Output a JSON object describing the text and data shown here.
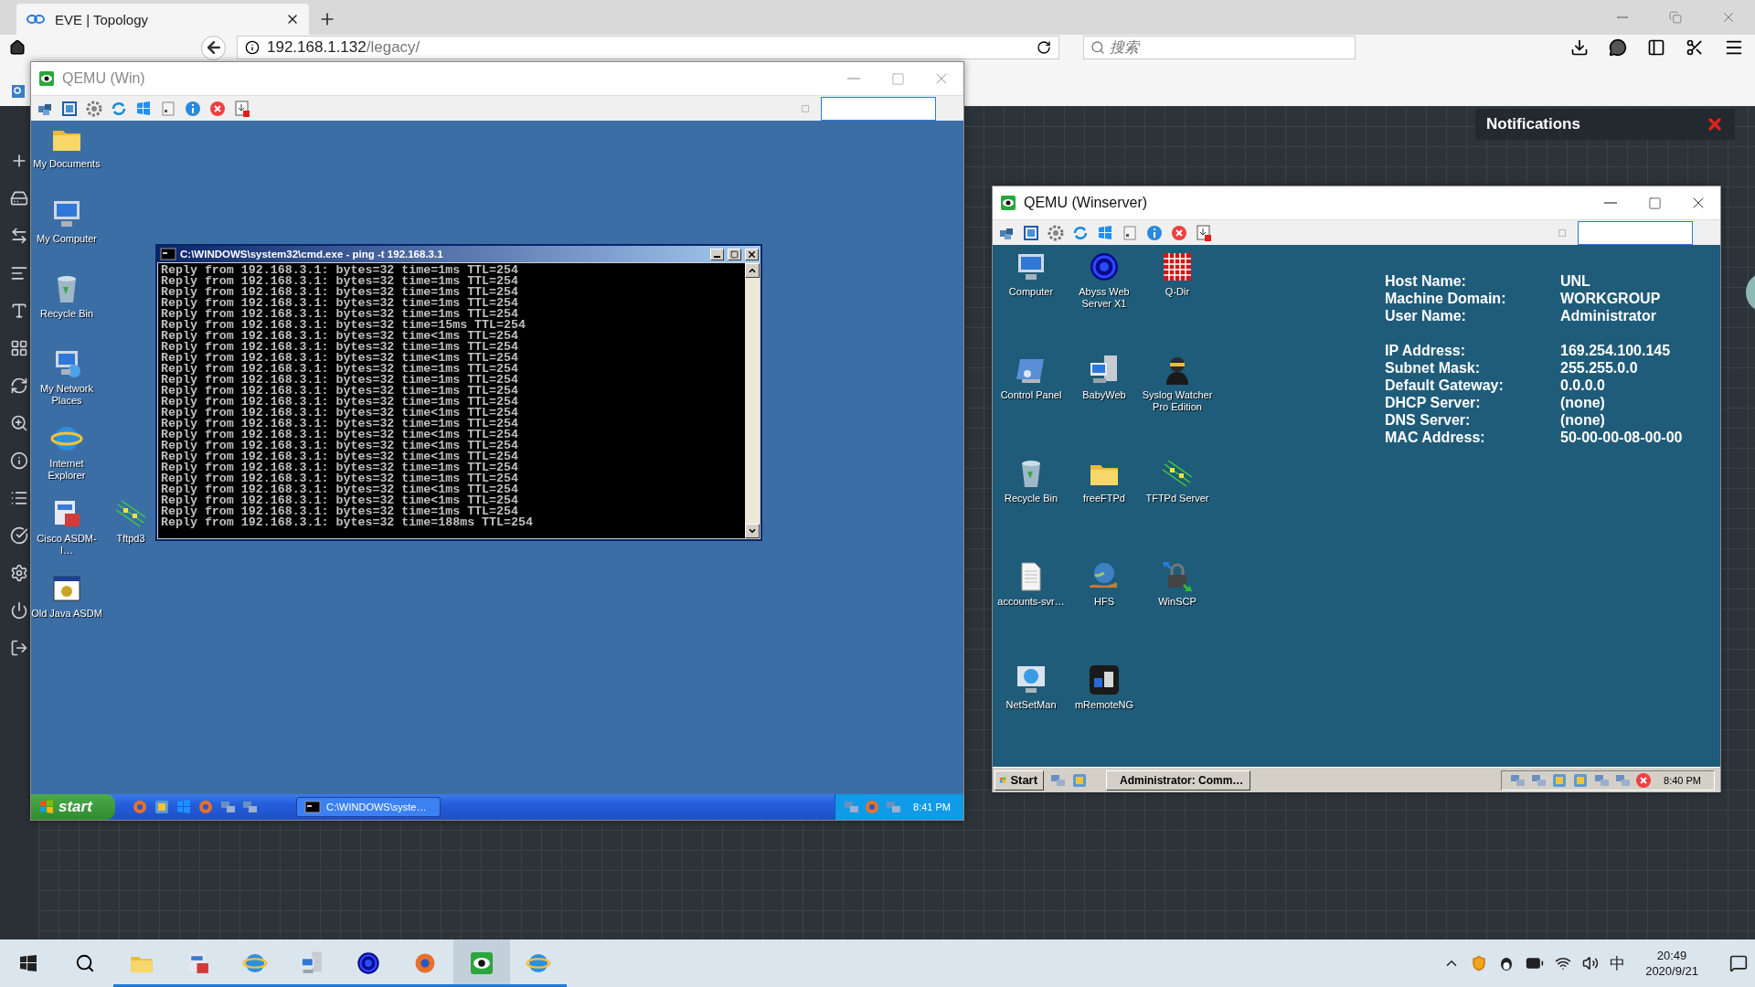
{
  "browser": {
    "tab": {
      "title": "EVE | Topology",
      "selected": true
    },
    "url": {
      "host": "192.168.1.132",
      "path": "/legacy/"
    },
    "search": {
      "placeholder": "搜索"
    }
  },
  "notifications": {
    "title": "Notifications"
  },
  "windows": [
    {
      "kind": "xp",
      "title": "QEMU (Win)",
      "active": false,
      "desktop_icons": [
        {
          "label": "My Documents"
        },
        {
          "label": "My Computer"
        },
        {
          "label": "Recycle Bin"
        },
        {
          "label": "My Network Places"
        },
        {
          "label": "Internet Explorer"
        },
        {
          "label": "Cisco ASDM-I…"
        },
        {
          "label": "Old Java ASDM"
        },
        {
          "label": "Tftpd3"
        }
      ],
      "console": {
        "title": "C:\\WINDOWS\\system32\\cmd.exe - ping -t 192.168.3.1",
        "lines": [
          "Reply from 192.168.3.1: bytes=32 time=1ms TTL=254",
          "Reply from 192.168.3.1: bytes=32 time=1ms TTL=254",
          "Reply from 192.168.3.1: bytes=32 time=1ms TTL=254",
          "Reply from 192.168.3.1: bytes=32 time=1ms TTL=254",
          "Reply from 192.168.3.1: bytes=32 time=1ms TTL=254",
          "Reply from 192.168.3.1: bytes=32 time=15ms TTL=254",
          "Reply from 192.168.3.1: bytes=32 time<1ms TTL=254",
          "Reply from 192.168.3.1: bytes=32 time=1ms TTL=254",
          "Reply from 192.168.3.1: bytes=32 time<1ms TTL=254",
          "Reply from 192.168.3.1: bytes=32 time=1ms TTL=254",
          "Reply from 192.168.3.1: bytes=32 time=1ms TTL=254",
          "Reply from 192.168.3.1: bytes=32 time=1ms TTL=254",
          "Reply from 192.168.3.1: bytes=32 time=1ms TTL=254",
          "Reply from 192.168.3.1: bytes=32 time<1ms TTL=254",
          "Reply from 192.168.3.1: bytes=32 time=1ms TTL=254",
          "Reply from 192.168.3.1: bytes=32 time<1ms TTL=254",
          "Reply from 192.168.3.1: bytes=32 time<1ms TTL=254",
          "Reply from 192.168.3.1: bytes=32 time<1ms TTL=254",
          "Reply from 192.168.3.1: bytes=32 time=1ms TTL=254",
          "Reply from 192.168.3.1: bytes=32 time=1ms TTL=254",
          "Reply from 192.168.3.1: bytes=32 time<1ms TTL=254",
          "Reply from 192.168.3.1: bytes=32 time<1ms TTL=254",
          "Reply from 192.168.3.1: bytes=32 time=1ms TTL=254",
          "Reply from 192.168.3.1: bytes=32 time=188ms TTL=254"
        ]
      },
      "taskbar": {
        "start": "start",
        "tasks": [
          {
            "label": "C:\\WINDOWS\\syste…",
            "selected": false
          }
        ],
        "clock": "8:41 PM"
      }
    },
    {
      "kind": "server",
      "title": "QEMU (Winserver)",
      "active": true,
      "desktop_icons": [
        {
          "label": "Computer"
        },
        {
          "label": "Abyss Web Server X1"
        },
        {
          "label": "Q-Dir"
        },
        {
          "label": "Control Panel"
        },
        {
          "label": "BabyWeb"
        },
        {
          "label": "Syslog Watcher Pro Edition"
        },
        {
          "label": "Recycle Bin"
        },
        {
          "label": "freeFTPd"
        },
        {
          "label": "TFTPd Server"
        },
        {
          "label": "accounts-svr…"
        },
        {
          "label": "HFS"
        },
        {
          "label": "WinSCP"
        },
        {
          "label": "NetSetMan"
        },
        {
          "label": "mRemoteNG"
        }
      ],
      "info": [
        [
          {
            "label": "Host Name:",
            "value": "UNL"
          },
          {
            "label": "Machine Domain:",
            "value": "WORKGROUP"
          },
          {
            "label": "User Name:",
            "value": "Administrator"
          }
        ],
        [
          {
            "label": "IP Address:",
            "value": "169.254.100.145"
          },
          {
            "label": "Subnet Mask:",
            "value": "255.255.0.0"
          },
          {
            "label": "Default Gateway:",
            "value": "0.0.0.0"
          },
          {
            "label": "DHCP Server:",
            "value": "(none)"
          },
          {
            "label": "DNS Server:",
            "value": "(none)"
          },
          {
            "label": "MAC Address:",
            "value": "50-00-00-08-00-00"
          }
        ]
      ],
      "taskbar": {
        "start": "Start",
        "tasks": [
          {
            "label": "Administrator: Comm…",
            "selected": false
          }
        ],
        "clock": "8:40 PM"
      }
    }
  ],
  "taskbar": {
    "apps": [
      {
        "running": true,
        "selected": false
      },
      {
        "running": true,
        "selected": false
      },
      {
        "running": true,
        "selected": false
      },
      {
        "running": true,
        "selected": false
      },
      {
        "running": true,
        "selected": false
      },
      {
        "running": true,
        "selected": false
      },
      {
        "running": true,
        "selected": true
      },
      {
        "running": true,
        "selected": false
      }
    ],
    "ime": "中",
    "time": "20:49",
    "date": "2020/9/21"
  }
}
